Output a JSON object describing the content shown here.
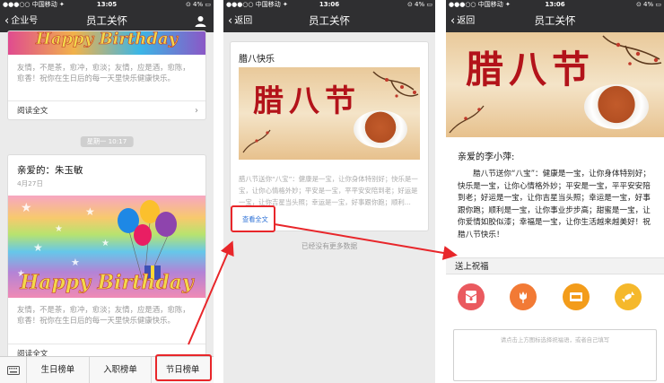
{
  "screens": [
    {
      "status": {
        "carrier": "●●●○○ 中国移动 ✦",
        "time": "13:05",
        "battery": "⊙ 4% ▭"
      },
      "nav": {
        "back": "企业号",
        "title": "员工关怀",
        "right_icon": "person-icon"
      },
      "card1": {
        "banner_text": "Happy Birthday",
        "snippet": "友情，不是茶，愈冲，愈淡；友情，应是酒，愈陈，愈香！祝你在生日后的每一天里快乐健康快乐。",
        "read_all": "阅读全文"
      },
      "time_pill": "星期一 10:17",
      "card2": {
        "title": "亲爱的：朱玉敏",
        "date": "4月27日",
        "banner_text": "Happy Birthday",
        "snippet": "友情，不是茶，愈冲，愈淡；友情，应是酒，愈陈，愈香！祝你在生日后的每一天里快乐健康快乐。",
        "read_all": "阅读全文"
      },
      "tabs": [
        "生日榜单",
        "入职榜单",
        "节日榜单"
      ]
    },
    {
      "status": {
        "carrier": "●●●○○ 中国移动 ✦",
        "time": "13:06",
        "battery": "⊙ 4% ▭"
      },
      "nav": {
        "back": "返回",
        "title": "员工关怀"
      },
      "card": {
        "title": "腊八快乐",
        "image_text": "腊八节",
        "snippet": "腊八节送你“八宝”：健康是一宝，让你身体特别好；快乐是一宝，让你心情格外妙；平安是一宝，平平安安陪到老；好运是一宝，让你吉星当头照；幸运是一宝，好事跟你跑；顺利...",
        "view_all": "查看全文"
      },
      "no_more": "已经没有更多数据"
    },
    {
      "status": {
        "carrier": "●●●○○ 中国移动 ✦",
        "time": "13:06",
        "battery": "⊙ 4% ▭"
      },
      "nav": {
        "back": "返回",
        "title": "员工关怀"
      },
      "image_text": "腊八节",
      "greeting": "亲爱的李小萍:",
      "body": "腊八节送你“八宝”：健康是一宝，让你身体特别好；快乐是一宝，让你心情格外妙；平安是一宝，平平安安陪到老；好运是一宝，让你吉星当头照；幸运是一宝，好事跟你跑；顺利是一宝，让你事业步步高；甜蜜是一宝，让你爱情likely如胶似漆；幸福是一宝，让你生活越来越美好！祝腊八节快乐！",
      "send_blessing": "送上祝福",
      "blessing_icons": [
        "red-envelope-icon",
        "flower-icon",
        "gift-card-icon",
        "candy-icon"
      ],
      "blessing_colors": [
        "#ea5a5f",
        "#f27a35",
        "#f39c1a",
        "#f5b82b"
      ],
      "textarea_placeholder": "请点击上方图标选择祝福语，或者自己填写"
    }
  ],
  "colors": {
    "navbar": "#2f2f31",
    "highlight": "#e8262a",
    "link": "#2a6fd6"
  }
}
